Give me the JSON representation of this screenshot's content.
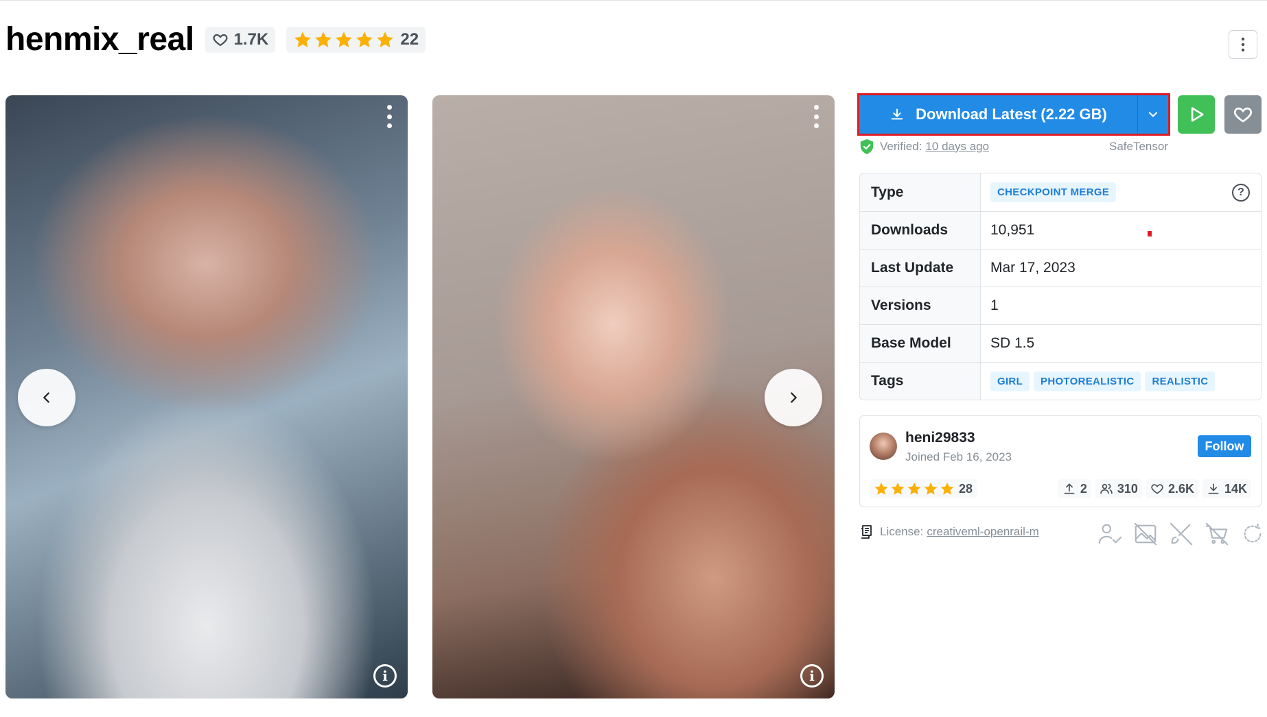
{
  "model": {
    "title": "henmix_real",
    "likes": "1.7K",
    "rating_count": "22",
    "rating_stars": 5
  },
  "icons": {
    "heart": "heart-icon",
    "star": "star-icon",
    "more": "vertical-dots-icon",
    "download": "download-icon",
    "caret": "chevron-down-icon",
    "run": "play-icon",
    "favorite": "heart-icon",
    "verified": "shield-check-icon",
    "help": "question-circle-icon",
    "license": "license-icon"
  },
  "gallery": {
    "prev_label": "‹",
    "next_label": "›",
    "info_label": "i"
  },
  "download": {
    "label": "Download Latest (2.22 GB)",
    "verified_label": "Verified:",
    "verified_when": "10 days ago",
    "format": "SafeTensor"
  },
  "details": {
    "type_label": "Type",
    "type_value": "CHECKPOINT MERGE",
    "downloads_label": "Downloads",
    "downloads_value": "10,951",
    "last_update_label": "Last Update",
    "last_update_value": "Mar 17, 2023",
    "versions_label": "Versions",
    "versions_value": "1",
    "base_model_label": "Base Model",
    "base_model_value": "SD 1.5",
    "tags_label": "Tags",
    "tags": [
      "GIRL",
      "PHOTOREALISTIC",
      "REALISTIC"
    ]
  },
  "creator": {
    "name": "heni29833",
    "joined": "Joined Feb 16, 2023",
    "follow_label": "Follow",
    "rating_count": "28",
    "uploads": "2",
    "followers": "310",
    "likes": "2.6K",
    "downloads": "14K"
  },
  "license": {
    "label": "License:",
    "name": "creativeml-openrail-m",
    "permission_icons": [
      "user-check-icon",
      "no-image-icon",
      "no-brush-icon",
      "no-cart-icon",
      "no-reuse-icon"
    ]
  },
  "colors": {
    "primary": "#228be6",
    "success": "#40c057",
    "gray": "#868e96",
    "star": "#fab005",
    "highlight": "#e01b24"
  }
}
